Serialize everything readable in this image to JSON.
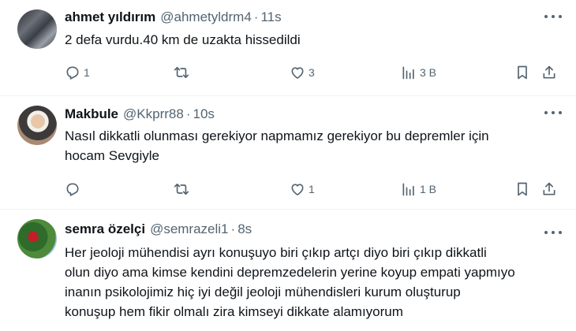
{
  "tweets": [
    {
      "name": "ahmet yıldırım",
      "handle": "@ahmetyldrm4",
      "dot": "·",
      "time": "11s",
      "lines": [
        "2 defa vurdu.40 km de uzakta hissedildi"
      ],
      "replies": "1",
      "retweets": "",
      "likes": "3",
      "views": "3 B"
    },
    {
      "name": "Makbule",
      "handle": "@Kkprr88",
      "dot": "·",
      "time": "10s",
      "lines": [
        "Nasıl dikkatli olunması gerekiyor  napmamız gerekiyor bu depremler için",
        "hocam Sevgiyle"
      ],
      "replies": "",
      "retweets": "",
      "likes": "1",
      "views": "1 B"
    },
    {
      "name": "semra özelçi",
      "handle": "@semrazeli1",
      "dot": "·",
      "time": "8s",
      "lines": [
        "Her jeoloji mühendisi ayrı konuşuyo biri çıkıp artçı diyo biri çıkıp dikkatli",
        "olun diyo ama kimse kendini depremzedelerin yerine koyup empati yapmıyo",
        "inanın psikolojimiz hiç iyi değil jeoloji mühendisleri kurum oluşturup",
        "konuşup hem fikir olmalı  zira kimseyi dikkate alamıyorum"
      ]
    }
  ],
  "icons": {
    "reply": "reply-icon",
    "retweet": "retweet-icon",
    "like": "heart-icon",
    "views": "views-icon",
    "bookmark": "bookmark-icon",
    "share": "share-icon",
    "more": "more-icon"
  },
  "colors": {
    "text": "#0f1419",
    "secondary": "#536471",
    "divider": "#eff3f4"
  }
}
